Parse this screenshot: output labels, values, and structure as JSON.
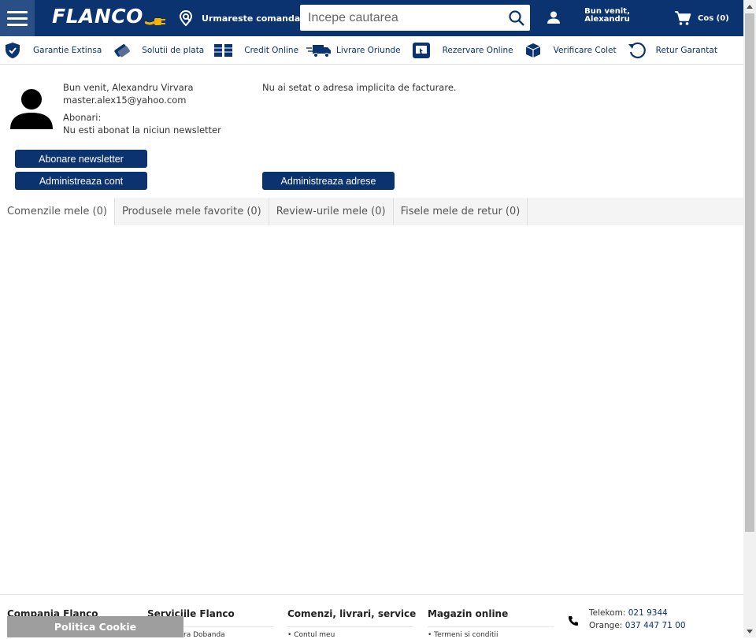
{
  "header": {
    "logo": "FLANCO",
    "track_order": "Urmareste comanda",
    "search_placeholder": "Incepe cautarea",
    "welcome_line1": "Bun venit,",
    "welcome_line2": "Alexandru",
    "cart": "Cos (0)"
  },
  "features": [
    {
      "label": "Garantie Extinsa",
      "icon": "shield-icon"
    },
    {
      "label": "Solutii de plata",
      "icon": "payment-icon"
    },
    {
      "label": "Credit Online",
      "icon": "credit-icon"
    },
    {
      "label": "Livrare Oriunde",
      "icon": "truck-icon"
    },
    {
      "label": "Rezervare Online",
      "icon": "reservation-icon"
    },
    {
      "label": "Verificare Colet",
      "icon": "box-icon"
    },
    {
      "label": "Retur Garantat",
      "icon": "return-icon"
    }
  ],
  "account": {
    "name_line": "Bun venit, Alexandru Virvara",
    "email": "master.alex15@yahoo.com",
    "subscriptions_label": "Abonari:",
    "subscriptions_value": "Nu esti abonat la niciun newsletter",
    "no_address": "Nu ai setat o adresa implicita de facturare."
  },
  "buttons": {
    "newsletter": "Abonare newsletter",
    "manage_account": "Administreaza cont",
    "manage_addresses": "Administreaza adrese"
  },
  "tabs": [
    {
      "label": "Comenzile mele (0)",
      "active": true
    },
    {
      "label": "Produsele mele favorite (0)",
      "active": false
    },
    {
      "label": "Review-urile mele (0)",
      "active": false
    },
    {
      "label": "Fisele mele de retur (0)",
      "active": false
    }
  ],
  "footer": {
    "columns": [
      "Compania Flanco",
      "Serviciile Flanco",
      "Comenzi, livrari, service",
      "Magazin online"
    ],
    "sub_items": [
      "ra Dobanda",
      "• Contul meu",
      "• Termeni si conditii"
    ],
    "telekom_label": "Telekom:",
    "telekom_number": "021 9344",
    "orange_label": "Orange:",
    "orange_number": "037 447 71 00",
    "cookie": "Politica Cookie"
  },
  "colors": {
    "brand": "#0b3370",
    "brand_light": "#2a4f87",
    "cookie_bg": "#9e9e9e"
  }
}
